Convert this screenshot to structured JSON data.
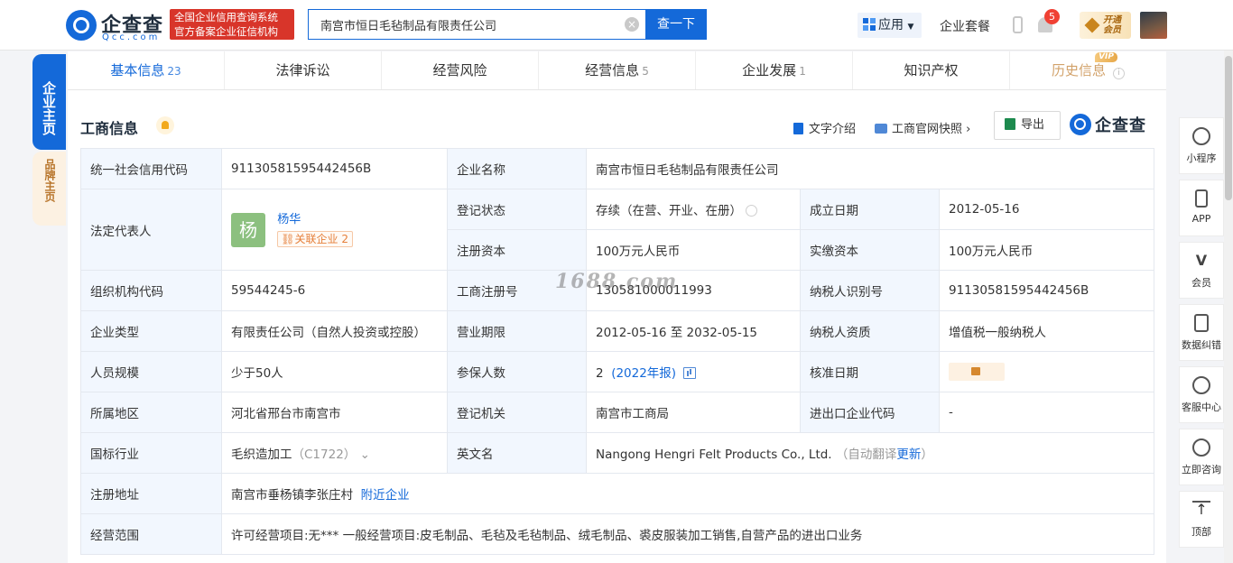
{
  "header": {
    "logo_cn": "企查查",
    "logo_en": "Qcc.com",
    "slogan_line1": "全国企业信用查询系统",
    "slogan_line2": "官方备案企业征信机构",
    "search_value": "南宫市恒日毛毡制品有限责任公司",
    "clear_glyph": "×",
    "search_button": "查一下",
    "app_menu": "应用",
    "package_link": "企业套餐",
    "notify_count": "5",
    "vip_line1": "开通",
    "vip_line2": "会员"
  },
  "left_tabs": {
    "home": "企业主页",
    "brand": "品牌主页"
  },
  "tabs": [
    {
      "label": "基本信息",
      "count": "23"
    },
    {
      "label": "法律诉讼",
      "count": ""
    },
    {
      "label": "经营风险",
      "count": ""
    },
    {
      "label": "经营信息",
      "count": "5"
    },
    {
      "label": "企业发展",
      "count": "1"
    },
    {
      "label": "知识产权",
      "count": ""
    },
    {
      "label": "历史信息",
      "count": "",
      "badge": "VIP",
      "info": "i"
    }
  ],
  "section": {
    "title": "工商信息",
    "intro_link": "文字介绍",
    "snapshot_link": "工商官网快照",
    "export_button": "导出",
    "brand_logo": "企查查"
  },
  "fields": {
    "credit_code_label": "统一社会信用代码",
    "credit_code": "91130581595442456B",
    "company_name_label": "企业名称",
    "company_name": "南宫市恒日毛毡制品有限责任公司",
    "legal_rep_label": "法定代表人",
    "legal_rep_avatar": "杨",
    "legal_rep_name": "杨华",
    "related_label": "关联企业",
    "related_count": "2",
    "reg_status_label": "登记状态",
    "reg_status": "存续（在营、开业、在册）",
    "est_date_label": "成立日期",
    "est_date": "2012-05-16",
    "reg_capital_label": "注册资本",
    "reg_capital": "100万元人民币",
    "paid_capital_label": "实缴资本",
    "paid_capital": "100万元人民币",
    "org_code_label": "组织机构代码",
    "org_code": "59544245-6",
    "biz_reg_no_label": "工商注册号",
    "biz_reg_no": "130581000011993",
    "taxpayer_id_label": "纳税人识别号",
    "taxpayer_id": "91130581595442456B",
    "company_type_label": "企业类型",
    "company_type": "有限责任公司（自然人投资或控股）",
    "biz_term_label": "营业期限",
    "biz_term": "2012-05-16 至 2032-05-15",
    "taxpayer_qual_label": "纳税人资质",
    "taxpayer_qual": "增值税一般纳税人",
    "staff_size_label": "人员规模",
    "staff_size": "少于50人",
    "insured_label": "参保人数",
    "insured_count": "2",
    "insured_report": "(2022年报)",
    "approval_date_label": "核准日期",
    "region_label": "所属地区",
    "region": "河北省邢台市南宫市",
    "reg_authority_label": "登记机关",
    "reg_authority": "南宫市工商局",
    "import_export_label": "进出口企业代码",
    "import_export": "-",
    "industry_label": "国标行业",
    "industry": "毛织造加工",
    "industry_code": "（C1722）",
    "english_name_label": "英文名",
    "english_name": "Nangong Hengri Felt Products Co., Ltd.",
    "auto_translate": "（自动翻译",
    "update_link": "更新",
    "close_paren": "）",
    "address_label": "注册地址",
    "address": "南宫市垂杨镇李张庄村",
    "nearby_link": "附近企业",
    "scope_label": "经营范围",
    "scope": "许可经营项目:无*** 一般经营项目:皮毛制品、毛毡及毛毡制品、绒毛制品、裘皮服装加工销售,自营产品的进出口业务"
  },
  "watermark": "1688.com",
  "right_rail": [
    {
      "label": "小程序",
      "icon": "miniprogram-icon"
    },
    {
      "label": "APP",
      "icon": "phone-icon"
    },
    {
      "label": "会员",
      "icon": "vip-icon"
    },
    {
      "label": "数据纠错",
      "icon": "edit-icon"
    },
    {
      "label": "客服中心",
      "icon": "headset-icon"
    },
    {
      "label": "立即咨询",
      "icon": "chat-icon"
    },
    {
      "label": "顶部",
      "icon": "back-to-top-icon"
    }
  ]
}
